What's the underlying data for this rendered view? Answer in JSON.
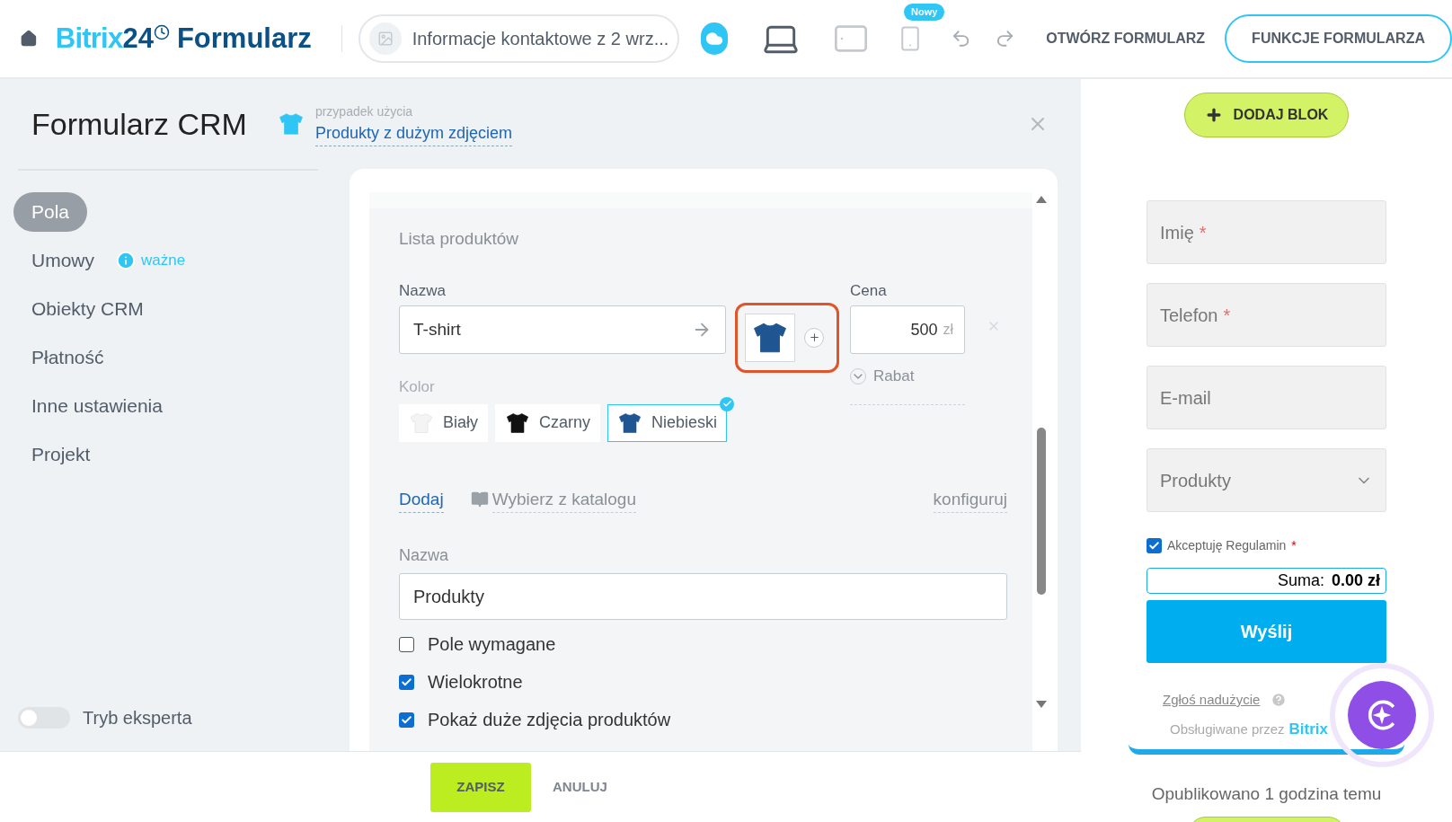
{
  "topbar": {
    "logo": {
      "brand": "Bitrix",
      "brand_number": "24",
      "product": "Formularz"
    },
    "form_selector": "Informacje kontaktowe z 2 wrz...",
    "devices": [
      {
        "kind": "laptop",
        "selected": true
      },
      {
        "kind": "tablet",
        "selected": false
      },
      {
        "kind": "phone",
        "selected": false,
        "badge": "Nowy"
      }
    ],
    "open_link": "OTWÓRZ FORMULARZ",
    "features_button": "FUNKCJE FORMULARZA"
  },
  "sidebar": {
    "title": "Formularz CRM",
    "use_case": {
      "caption": "przypadek użycia",
      "link": "Produkty z dużym zdjęciem"
    },
    "items": [
      {
        "label": "Pola",
        "selected": true
      },
      {
        "label": "Umowy",
        "selected": false,
        "note": "ważne"
      },
      {
        "label": "Obiekty CRM",
        "selected": false
      },
      {
        "label": "Płatność",
        "selected": false
      },
      {
        "label": "Inne ustawienia",
        "selected": false
      },
      {
        "label": "Projekt",
        "selected": false
      }
    ],
    "expert_mode": {
      "label": "Tryb eksperta",
      "on": false
    }
  },
  "editor": {
    "section_title": "Lista produktów",
    "product": {
      "name_label": "Nazwa",
      "name_value": "T-shirt",
      "price_label": "Cena",
      "price_value": "500",
      "currency": "zł",
      "discount": "Rabat",
      "color_label": "Kolor",
      "colors": [
        {
          "label": "Biały",
          "color": "#f4f4f4",
          "selected": false
        },
        {
          "label": "Czarny",
          "color": "#111111",
          "selected": false
        },
        {
          "label": "Niebieski",
          "color": "#1f5591",
          "selected": true
        }
      ]
    },
    "actions": {
      "add": "Dodaj",
      "catalog": "Wybierz z katalogu",
      "configure": "konfiguruj"
    },
    "field_name": {
      "label": "Nazwa",
      "value": "Produkty"
    },
    "options": [
      {
        "label": "Pole wymagane",
        "checked": false
      },
      {
        "label": "Wielokrotne",
        "checked": true
      },
      {
        "label": "Pokaż duże zdjęcia produktów",
        "checked": true
      }
    ]
  },
  "footer": {
    "save": "ZAPISZ",
    "cancel": "ANULUJ"
  },
  "preview": {
    "add_block": "DODAJ BLOK",
    "fields": [
      {
        "kind": "text",
        "label": "Imię",
        "required_mark": "*"
      },
      {
        "kind": "text",
        "label": "Telefon",
        "required_mark": "*"
      },
      {
        "kind": "text",
        "label": "E-mail"
      },
      {
        "kind": "select",
        "label": "Produkty"
      }
    ],
    "consent": {
      "label": "Akceptuję Regulamin",
      "checked": true,
      "required_mark": "*"
    },
    "total": {
      "label": "Suma:",
      "value": "0.00 zł"
    },
    "submit": "Wyślij",
    "report": "Zgłoś nadużycie",
    "powered": {
      "text": "Obsługiwane przez",
      "brand": "Bitrix"
    },
    "published": "Opublikowano 1 godzina temu"
  }
}
